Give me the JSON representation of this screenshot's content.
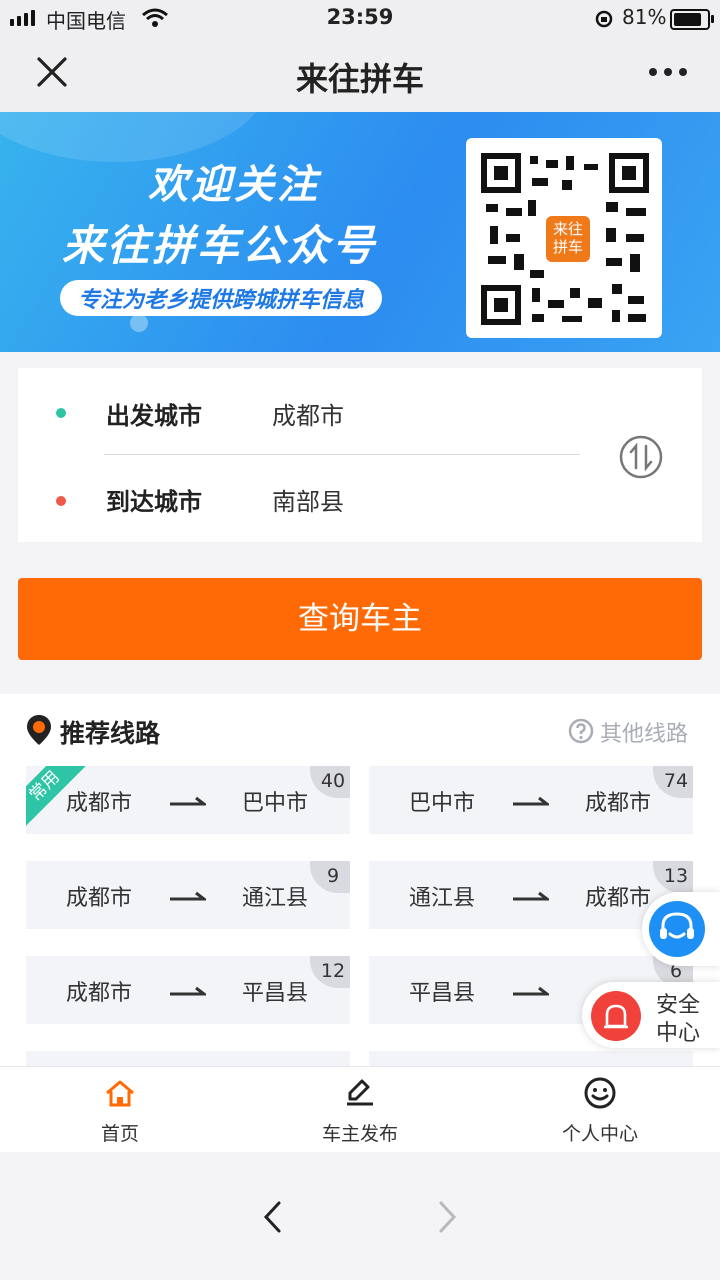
{
  "status_bar": {
    "carrier": "中国电信",
    "time": "23:59",
    "battery": "81%"
  },
  "nav": {
    "title": "来往拼车"
  },
  "banner": {
    "line1": "欢迎关注",
    "line2": "来往拼车公众号",
    "tagline": "专注为老乡提供跨城拼车信息",
    "qr_logo": "来往拼车"
  },
  "route": {
    "from_label": "出发城市",
    "from_value": "成都市",
    "to_label": "到达城市",
    "to_value": "南部县"
  },
  "query_button": "查询车主",
  "recommended": {
    "title": "推荐线路",
    "more": "其他线路",
    "badge": "常用",
    "routes": [
      {
        "from": "成都市",
        "to": "巴中市",
        "count": "40"
      },
      {
        "from": "巴中市",
        "to": "成都市",
        "count": "74"
      },
      {
        "from": "成都市",
        "to": "通江县",
        "count": "9"
      },
      {
        "from": "通江县",
        "to": "成都市",
        "count": "13"
      },
      {
        "from": "成都市",
        "to": "平昌县",
        "count": "12"
      },
      {
        "from": "平昌县",
        "to": "",
        "count": "6"
      }
    ]
  },
  "floating": {
    "safety_line1": "安全",
    "safety_line2": "中心"
  },
  "tabbar": {
    "home": "首页",
    "publish": "车主发布",
    "profile": "个人中心"
  },
  "colors": {
    "accent": "#ff6a07",
    "from_dot": "#2ec4a6",
    "to_dot": "#f0594a",
    "blue": "#2c8cf0"
  }
}
